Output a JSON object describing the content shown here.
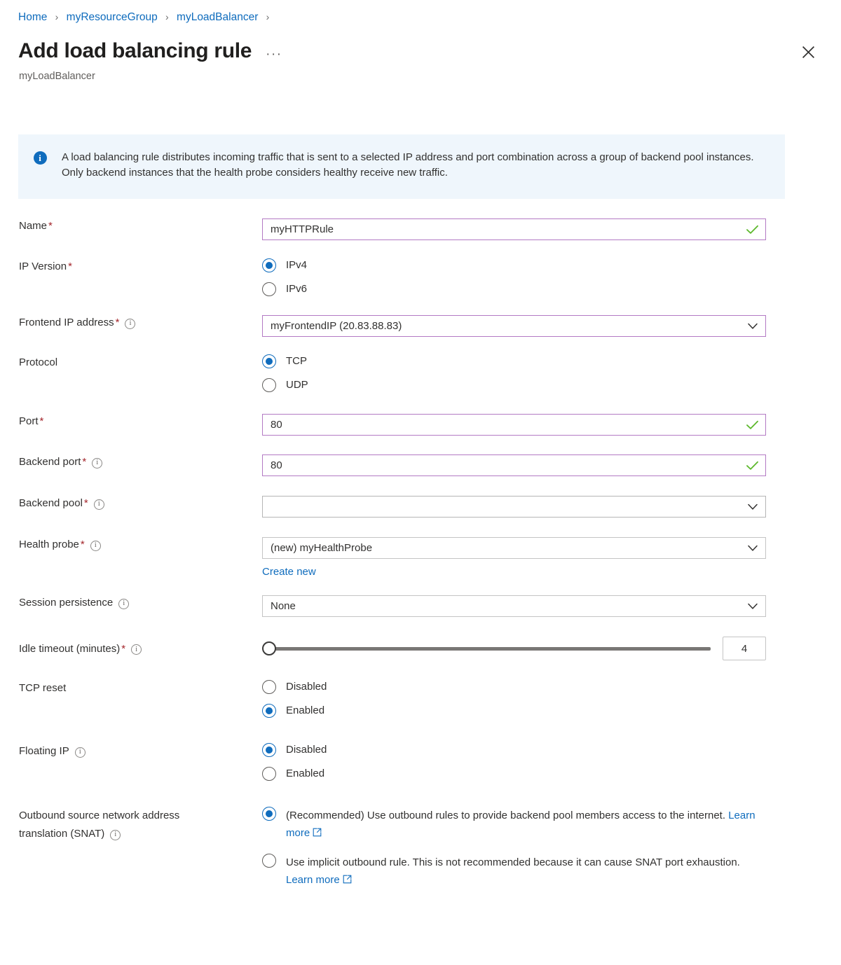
{
  "breadcrumb": {
    "items": [
      "Home",
      "myResourceGroup",
      "myLoadBalancer"
    ],
    "separator": "›"
  },
  "header": {
    "title": "Add load balancing rule",
    "subtitle": "myLoadBalancer",
    "more_label": "···",
    "close_icon": "close-icon"
  },
  "banner": {
    "icon": "info-icon",
    "text": "A load balancing rule distributes incoming traffic that is sent to a selected IP address and port combination across a group of backend pool instances. Only backend instances that the health probe considers healthy receive new traffic."
  },
  "form": {
    "name": {
      "label": "Name",
      "required": true,
      "value": "myHTTPRule",
      "placeholder": "",
      "valid": true
    },
    "ip_version": {
      "label": "IP Version",
      "required": true,
      "options": [
        {
          "label": "IPv4",
          "selected": true
        },
        {
          "label": "IPv6",
          "selected": false
        }
      ]
    },
    "frontend_ip": {
      "label": "Frontend IP address",
      "required": true,
      "info": true,
      "value": "myFrontendIP (20.83.88.83)"
    },
    "protocol": {
      "label": "Protocol",
      "required": false,
      "options": [
        {
          "label": "TCP",
          "selected": true
        },
        {
          "label": "UDP",
          "selected": false
        }
      ]
    },
    "port": {
      "label": "Port",
      "required": true,
      "value": "80",
      "valid": true
    },
    "backend_port": {
      "label": "Backend port",
      "required": true,
      "info": true,
      "value": "80",
      "valid": true
    },
    "backend_pool": {
      "label": "Backend pool",
      "required": true,
      "info": true,
      "value": ""
    },
    "health_probe": {
      "label": "Health probe",
      "required": true,
      "info": true,
      "value": "(new) myHealthProbe",
      "create_new_label": "Create new"
    },
    "session_persistence": {
      "label": "Session persistence",
      "required": false,
      "info": true,
      "value": "None"
    },
    "idle_timeout": {
      "label": "Idle timeout (minutes)",
      "required": true,
      "info": true,
      "value": "4",
      "min": 4,
      "max": 30,
      "percent": 0
    },
    "tcp_reset": {
      "label": "TCP reset",
      "required": false,
      "options": [
        {
          "label": "Disabled",
          "selected": false
        },
        {
          "label": "Enabled",
          "selected": true
        }
      ]
    },
    "floating_ip": {
      "label": "Floating IP",
      "required": false,
      "info": true,
      "options": [
        {
          "label": "Disabled",
          "selected": true
        },
        {
          "label": "Enabled",
          "selected": false
        }
      ]
    },
    "snat": {
      "label_line1": "Outbound source network address",
      "label_line2": "translation (SNAT)",
      "info": true,
      "options": [
        {
          "text": "(Recommended) Use outbound rules to provide backend pool members access to the internet.",
          "link_label": "Learn more",
          "selected": true
        },
        {
          "text": "Use implicit outbound rule. This is not recommended because it can cause SNAT port exhaustion.",
          "link_label": "Learn more",
          "selected": false
        }
      ]
    }
  },
  "colors": {
    "accent_blue": "#0f6cbd",
    "banner_bg": "#eff6fc",
    "field_accent_border": "#b37ac4",
    "valid_check_green": "#5cb82b",
    "required_red": "#a4262c"
  }
}
